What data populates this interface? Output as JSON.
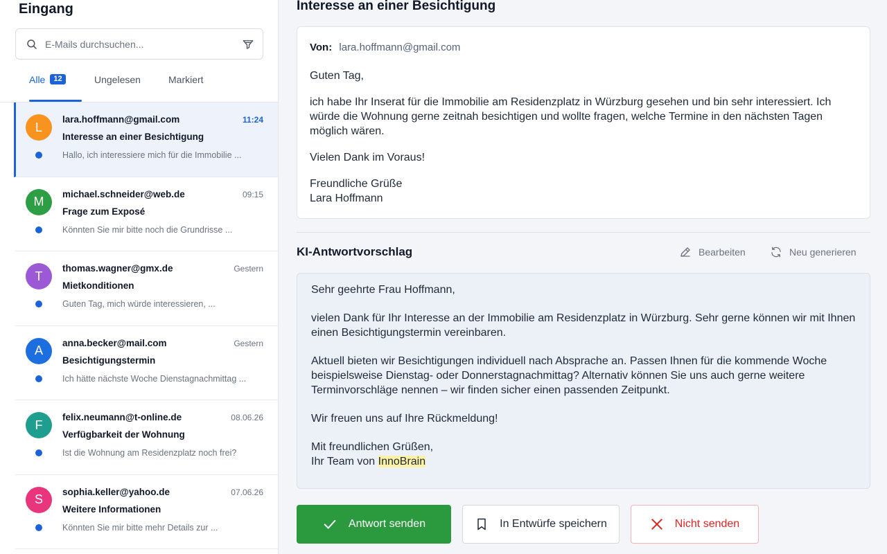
{
  "sidebar": {
    "title": "Eingang",
    "search_placeholder": "E-Mails durchsuchen...",
    "tabs": [
      {
        "label": "Alle",
        "badge": "12"
      },
      {
        "label": "Ungelesen"
      },
      {
        "label": "Markiert"
      }
    ],
    "mails": [
      {
        "initial": "L",
        "color": "#f7931e",
        "from": "lara.hoffmann@gmail.com",
        "time": "11:24",
        "subject": "Interesse an einer Besichtigung",
        "preview": "Hallo, ich interessiere mich für die Immobilie ..."
      },
      {
        "initial": "M",
        "color": "#2e9e44",
        "from": "michael.schneider@web.de",
        "time": "09:15",
        "subject": "Frage zum Exposé",
        "preview": "Könnten Sie mir bitte noch die Grundrisse ..."
      },
      {
        "initial": "T",
        "color": "#9b59d6",
        "from": "thomas.wagner@gmx.de",
        "time": "Gestern",
        "subject": "Mietkonditionen",
        "preview": "Guten Tag, mich würde interessieren, ..."
      },
      {
        "initial": "A",
        "color": "#1d6fe0",
        "from": "anna.becker@mail.com",
        "time": "Gestern",
        "subject": "Besichtigungstermin",
        "preview": "Ich hätte nächste Woche Dienstagnachmittag ..."
      },
      {
        "initial": "F",
        "color": "#1f9e8f",
        "from": "felix.neumann@t-online.de",
        "time": "08.06.26",
        "subject": "Verfügbarkeit der Wohnung",
        "preview": "Ist die Wohnung am Residenzplatz noch frei?"
      },
      {
        "initial": "S",
        "color": "#e8357c",
        "from": "sophia.keller@yahoo.de",
        "time": "07.06.26",
        "subject": "Weitere Informationen",
        "preview": "Könnten Sie mir bitte mehr Details zur ..."
      }
    ]
  },
  "email": {
    "title": "Interesse an einer Besichtigung",
    "from_label": "Von:",
    "from": "lara.hoffmann@gmail.com",
    "greeting": "Guten Tag,",
    "paragraph": "ich habe Ihr Inserat für die Immobilie am Residenzplatz in Würzburg gesehen und bin sehr interessiert. Ich würde die Wohnung gerne zeitnah besichtigen und wollte fragen, welche Termine in den nächsten Tagen möglich wären.",
    "thanks": "Vielen Dank im Voraus!",
    "closing": "Freundliche Grüße",
    "signature": "Lara Hoffmann"
  },
  "ai": {
    "title": "KI-Antwortvorschlag",
    "edit_label": "Bearbeiten",
    "regenerate_label": "Neu generieren",
    "salutation": "Sehr geehrte Frau Hoffmann,",
    "p1": "vielen Dank für Ihr Interesse an der Immobilie am Residenzplatz in Würzburg. Sehr gerne können wir mit Ihnen einen Besichtigungstermin vereinbaren.",
    "p2": "Aktuell bieten wir Besichtigungen individuell nach Absprache an. Passen Ihnen für die kommende Woche beispielsweise Dienstag- oder Donnerstagnachmittag? Alternativ können Sie uns auch gerne weitere Terminvorschläge nennen – wir finden sicher einen passenden Zeitpunkt.",
    "p3": "Wir freuen uns auf Ihre Rückmeldung!",
    "closing": "Mit freundlichen Grüßen,",
    "team_prefix": "Ihr Team von ",
    "company": "InnoBrain"
  },
  "actions": {
    "send": "Antwort senden",
    "draft": "In Entwürfe speichern",
    "reject": "Nicht senden"
  },
  "colors": {
    "accent": "#1d63d8",
    "send": "#2b9a3e",
    "reject": "#e02424",
    "highlight": "#fdf1a6"
  }
}
